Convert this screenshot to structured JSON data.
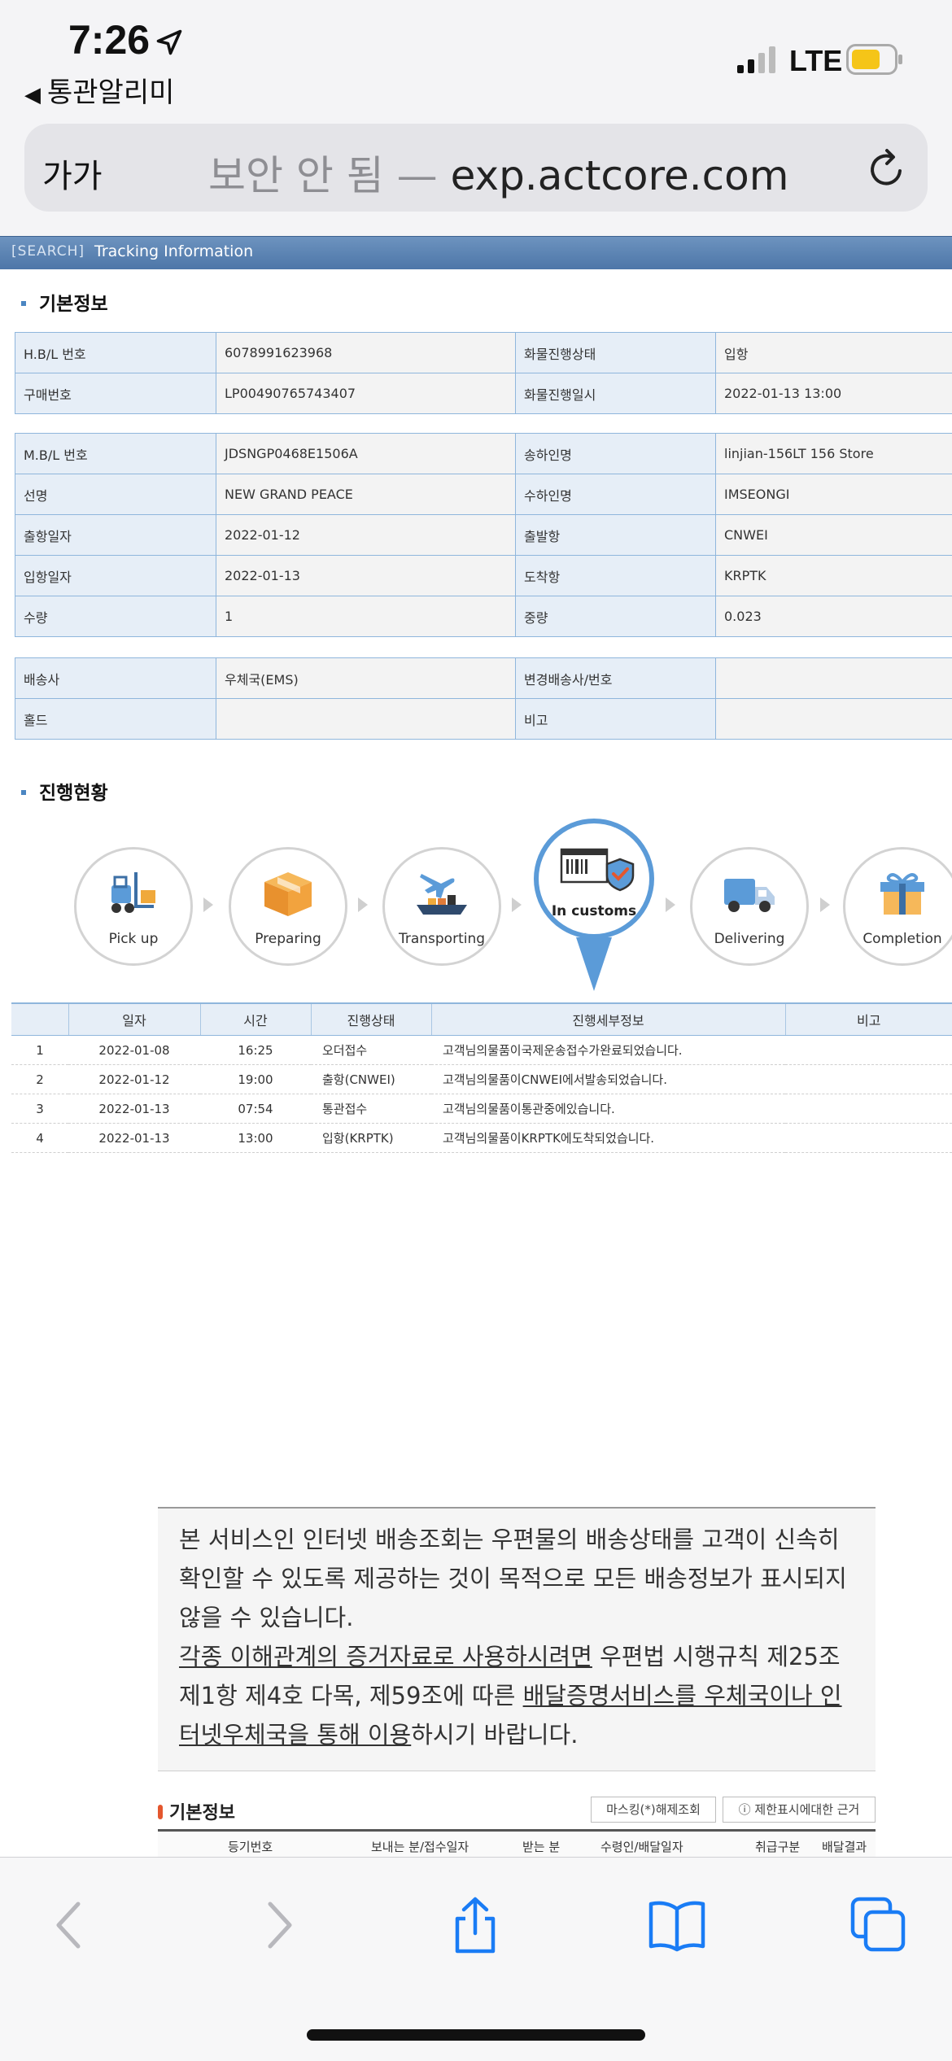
{
  "status_bar": {
    "time": "7:26",
    "back_app": "통관알리미",
    "carrier": "LTE"
  },
  "browser": {
    "text_size_button": "가가",
    "url_insecure": "보안 안 됨 —",
    "url_domain": "exp.actcore.com"
  },
  "page_header": {
    "tag": "[SEARCH]",
    "title": "Tracking Information"
  },
  "basic_info": {
    "title": "기본정보",
    "table1": [
      [
        "H.B/L 번호",
        "6078991623968",
        "화물진행상태",
        "입항"
      ],
      [
        "구매번호",
        "LP00490765743407",
        "화물진행일시",
        "2022-01-13 13:00"
      ]
    ],
    "table2": [
      [
        "M.B/L 번호",
        "JDSNGP0468E1506A",
        "송하인명",
        "linjian-156LT 156 Store"
      ],
      [
        "선명",
        "NEW GRAND PEACE",
        "수하인명",
        "IMSEONGI"
      ],
      [
        "출항일자",
        "2022-01-12",
        "출발항",
        "CNWEI"
      ],
      [
        "입항일자",
        "2022-01-13",
        "도착항",
        "KRPTK"
      ],
      [
        "수량",
        "1",
        "중량",
        "0.023"
      ]
    ],
    "table3": [
      [
        "배송사",
        "우체국(EMS)",
        "변경배송사/번호",
        ""
      ],
      [
        "홀드",
        "",
        "비고",
        ""
      ]
    ]
  },
  "progress": {
    "title": "진행현황",
    "steps": [
      {
        "label": "Pick up",
        "icon": "forklift-icon"
      },
      {
        "label": "Preparing",
        "icon": "box-icon"
      },
      {
        "label": "Transporting",
        "icon": "plane-ship-icon"
      },
      {
        "label": "In customs",
        "icon": "customs-icon",
        "active": true
      },
      {
        "label": "Delivering",
        "icon": "truck-icon"
      },
      {
        "label": "Completion",
        "icon": "gift-icon"
      }
    ],
    "headers": [
      "",
      "일자",
      "시간",
      "진행상태",
      "진행세부정보",
      "비고"
    ],
    "rows": [
      [
        "1",
        "2022-01-08",
        "16:25",
        "오더접수",
        "고객님의물품이국제운송접수가완료되었습니다.",
        ""
      ],
      [
        "2",
        "2022-01-12",
        "19:00",
        "출항(CNWEI)",
        "고객님의물품이CNWEI에서발송되었습니다.",
        ""
      ],
      [
        "3",
        "2022-01-13",
        "07:54",
        "통관접수",
        "고객님의물품이통관중에있습니다.",
        ""
      ],
      [
        "4",
        "2022-01-13",
        "13:00",
        "입항(KRPTK)",
        "고객님의물품이KRPTK에도착되었습니다.",
        ""
      ]
    ]
  },
  "notice": {
    "para1": "본 서비스인 인터넷 배송조회는 우편물의 배송상태를 고객이 신속히 확인할 수 있도록 제공하는 것이 목적으로 모든 배송정보가 표시되지 않을 수 있습니다.",
    "para2_u1": "각종 이해관계의 증거자료로 사용하시려면",
    "para2_t1": " 우편법 시행규칙 제25조 제1항 제4호 다목, 제59조에 따른 ",
    "para2_u2": "배달증명서비스를 우체국이나 인터넷우체국을 통해 이용",
    "para2_t2": "하시기 바랍니다."
  },
  "bottom_info": {
    "title": "기본정보",
    "btn_unmask": "마스킹(*)해제조회",
    "btn_reason": "ⓘ 제한표시에대한 근거",
    "headers": [
      "등기번호",
      "보내는 분/접수일자",
      "받는 분",
      "수령인/배달일자",
      "취급구분",
      "배달결과"
    ]
  },
  "colors": {
    "header_blue": "#4d76a8",
    "border_blue": "#8fb6dc",
    "ios_blue": "#1a7cf5",
    "active_ring": "#5b9bd8"
  }
}
